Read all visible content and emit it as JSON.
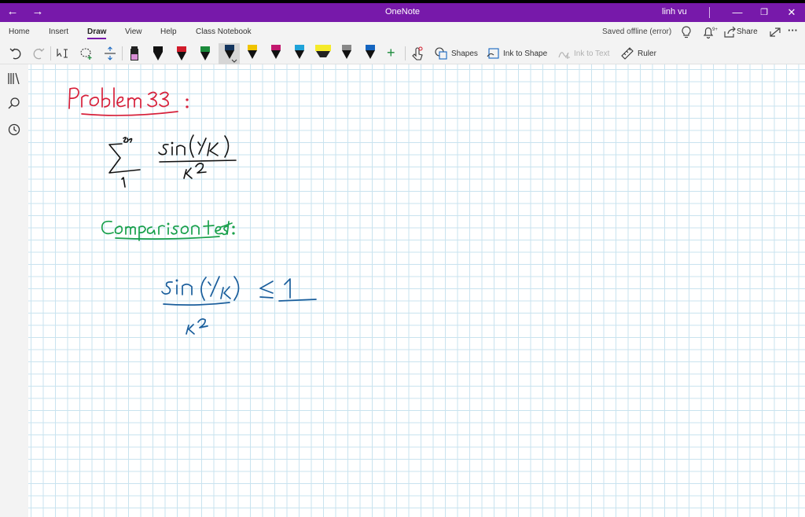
{
  "window": {
    "title": "OneNote",
    "user": "linh vu",
    "back_glyph": "←",
    "forward_glyph": "→",
    "minimize_glyph": "—",
    "restore_glyph": "❐",
    "close_glyph": "✕"
  },
  "ribbon": {
    "tabs": [
      {
        "label": "Home"
      },
      {
        "label": "Insert"
      },
      {
        "label": "Draw"
      },
      {
        "label": "View"
      },
      {
        "label": "Help"
      },
      {
        "label": "Class Notebook"
      }
    ],
    "active_tab": "Draw",
    "status": "Saved offline (error)",
    "notification_badge": "9+",
    "share_label": "Share",
    "more_glyph": "···"
  },
  "toolbar": {
    "shapes_label": "Shapes",
    "ink_to_shape_label": "Ink to Shape",
    "ink_to_text_label": "Ink to Text",
    "ruler_label": "Ruler",
    "pens": [
      {
        "name": "pink-highlighter",
        "color": "#d98fd6"
      },
      {
        "name": "black-pen",
        "color": "#111111"
      },
      {
        "name": "red-pen",
        "color": "#d11b2a"
      },
      {
        "name": "green-pen",
        "color": "#1a8a3a"
      },
      {
        "name": "navy-pen",
        "color": "#13355e"
      },
      {
        "name": "yellow-pen",
        "color": "#f0c400"
      },
      {
        "name": "magenta-pen",
        "color": "#c2186f"
      },
      {
        "name": "cyan-pen",
        "color": "#1fa3d9"
      },
      {
        "name": "yellow-highlighter",
        "color": "#f5ea2a"
      },
      {
        "name": "gray-pen",
        "color": "#888888"
      },
      {
        "name": "blue-pen",
        "color": "#1565c0"
      }
    ],
    "add_pen_glyph": "+"
  },
  "colors": {
    "accent": "#7719aa",
    "grid": "#c9e3ef",
    "ink_red": "#d6203a",
    "ink_black": "#111111",
    "ink_green": "#19a04b",
    "ink_blue": "#1a5e9c"
  },
  "page": {
    "handwriting": [
      "Problem 33 :",
      "∑ from 1 to ∞ of sin(1/k) / k²",
      "Comparison test :",
      "sin(1/k) / k² ≤ 1"
    ]
  }
}
